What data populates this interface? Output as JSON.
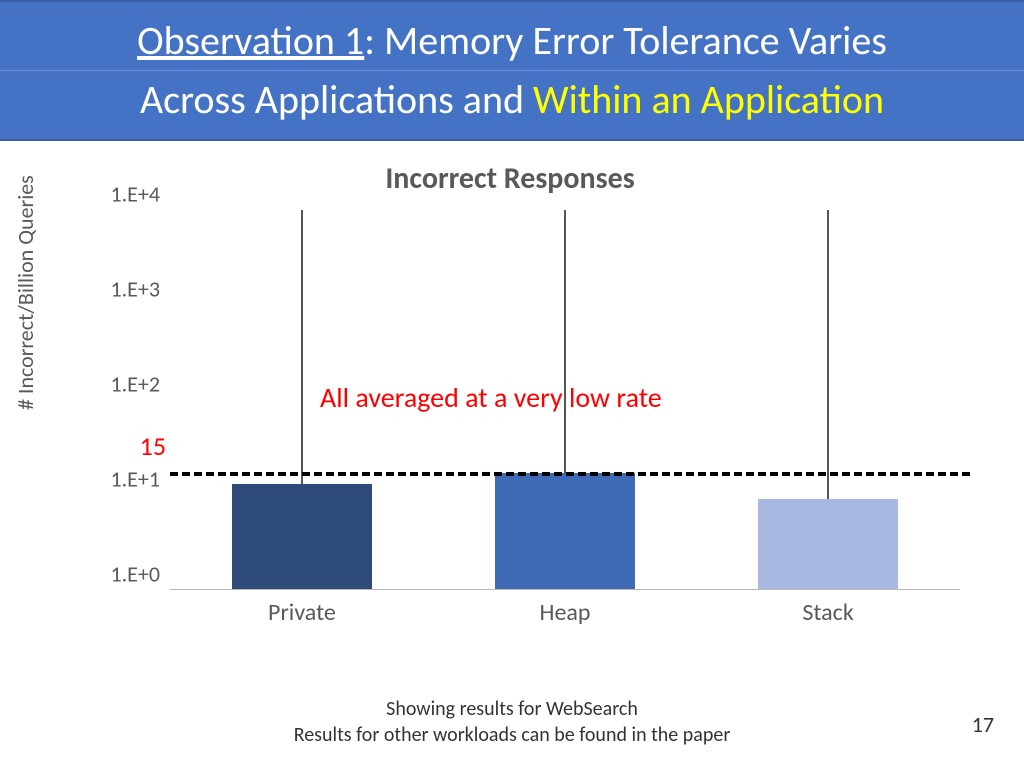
{
  "title": {
    "obs_label": "Observation 1",
    "part1": ": Memory Error Tolerance Varies",
    "part2a": "Across Applications and ",
    "part2b": "Within an Application"
  },
  "chart_data": {
    "type": "bar",
    "title": "Incorrect Responses",
    "ylabel": "# Incorrect/Billion Queries",
    "xlabel": "",
    "y_scale": "log",
    "ylim": [
      1,
      10000
    ],
    "y_ticks": [
      "1.E+0",
      "1.E+1",
      "1.E+2",
      "1.E+3",
      "1.E+4"
    ],
    "categories": [
      "Private",
      "Heap",
      "Stack"
    ],
    "values": [
      13,
      17,
      9
    ],
    "error_upper": [
      10000,
      10000,
      10000
    ],
    "threshold": {
      "value": 15,
      "label": "15"
    },
    "annotation": "All averaged at a very low rate",
    "colors": {
      "Private": "#2f4b7c",
      "Heap": "#3f6ab5",
      "Stack": "#a9b8e0"
    }
  },
  "footnote": {
    "line1": "Showing results for WebSearch",
    "line2": "Results for other workloads can be found in the paper"
  },
  "page_number": "17"
}
